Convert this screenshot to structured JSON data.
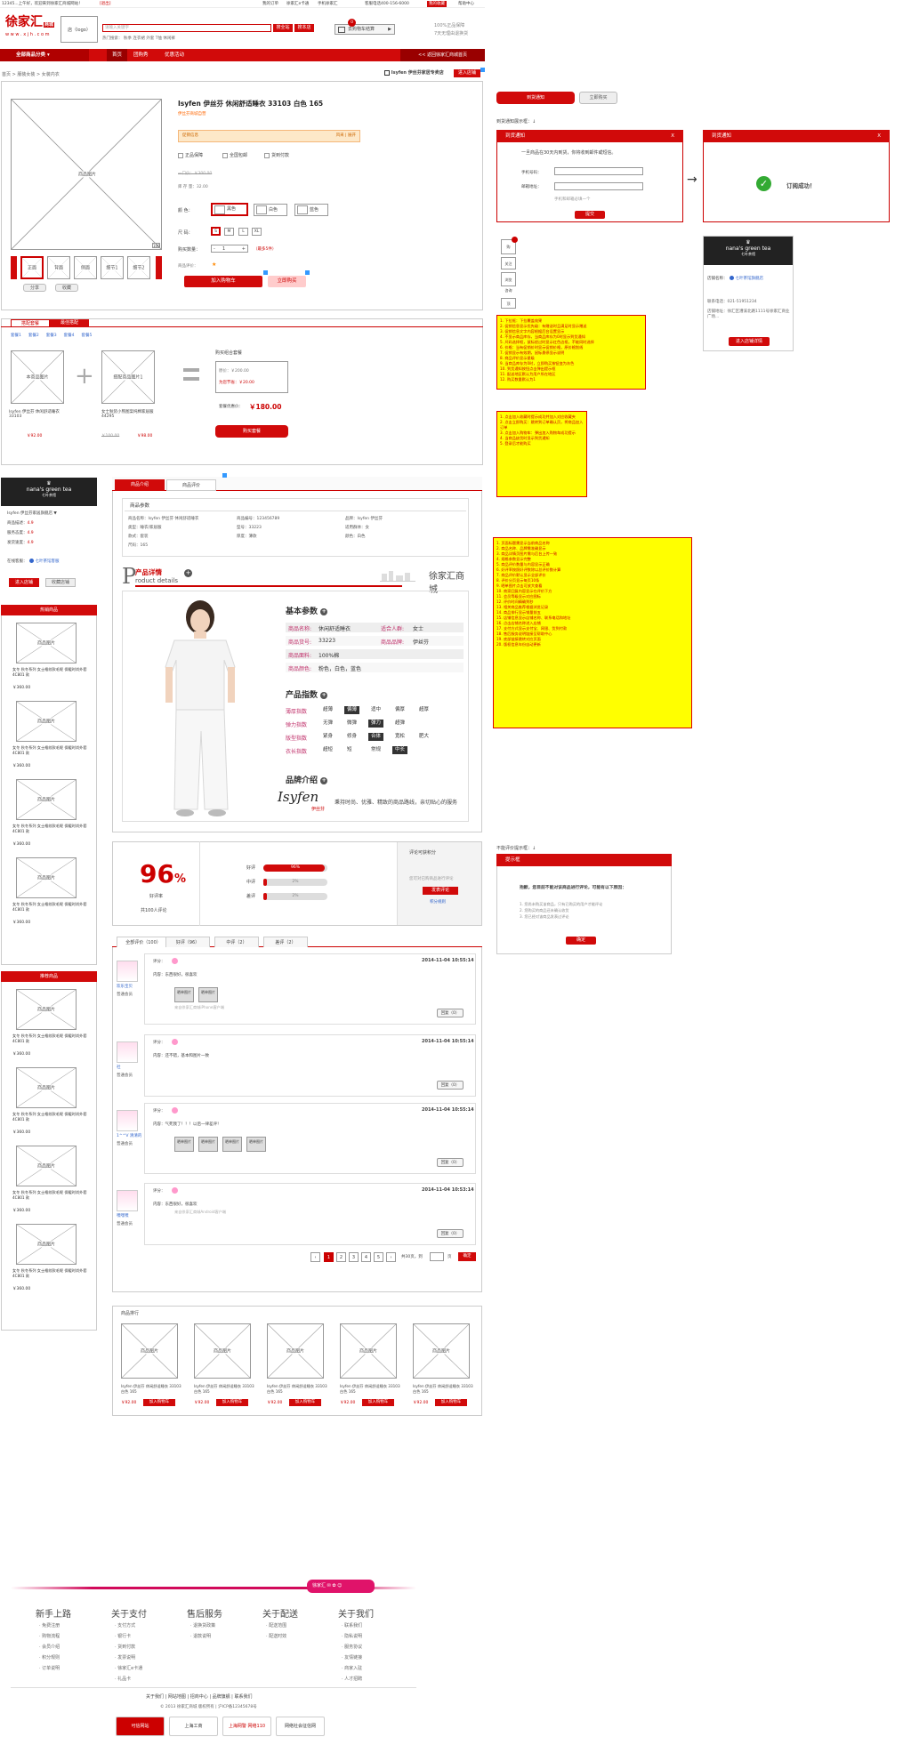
{
  "topbar": {
    "greeting": "12345...上午好，欢迎来到徐家汇商城网站！",
    "logout": "[退出]",
    "links": [
      "我的订单",
      "徐家汇e卡通",
      "手机徐家汇",
      "客服电话400-156-6000",
      "我的收藏",
      "帮助中心"
    ],
    "fav_btn": "加入收藏"
  },
  "header": {
    "logo_cn": "徐家汇",
    "logo_sub": "商城",
    "logo_url": "w w w . x j h . c o m",
    "store_logo": "店（logo）",
    "search_placeholder": "请输入关键字",
    "search_btn": "搜全站",
    "search_store_btn": "搜本店",
    "hot_words": "热门搜索：  秋季  连衣裙  外套  T恤  休闲裤",
    "cart_label": "去购物车结算",
    "cart_count": "0",
    "slogan1": "100%正品保障",
    "slogan2": "7天无理由退换货"
  },
  "nav": {
    "all_categories": "全部商品分类",
    "items": [
      "首页",
      "团购秀",
      "优惠活动"
    ],
    "back_link": "<< 返回徐家汇商城首页"
  },
  "breadcrumb": "首页 > 服装女装 > 女装内衣",
  "store_bar": {
    "name": "Isyfen 伊丝芬家居专卖店",
    "enter": "进入店铺"
  },
  "product": {
    "title": "Isyfen 伊丝芬 休闲舒适睡衣 33103 白色 165",
    "subtitle": "伊丝芬商城自营",
    "promo_label": "促销信息",
    "promo_more": "风采 | 展开",
    "service": [
      "正品保障",
      "全国包邮",
      "货到付款"
    ],
    "price_line": "一口价：￥300.00",
    "stock": "库 存 量：32.00",
    "color_label": "颜 色：",
    "colors": [
      "黑色",
      "白色",
      "蓝色"
    ],
    "size_label": "尺 码：",
    "sizes": [
      "S",
      "M",
      "L",
      "XL"
    ],
    "qty_label": "购买数量：",
    "qty": "1",
    "qty_note": "（最多5件）",
    "rating_label": "商品评价：",
    "add_cart": "加入购物车",
    "buy_now": "立即购买",
    "thumbs": [
      "正面",
      "背面",
      "侧面",
      "细节1",
      "细节2"
    ],
    "share": "分享",
    "collect": "收藏",
    "main_img": "商品图片"
  },
  "bundle": {
    "tabs": [
      "搭配套餐",
      "最佳搭配"
    ],
    "groups": [
      "套餐1",
      "套餐2",
      "套餐3",
      "套餐4",
      "套餐5"
    ],
    "item1": "本商品图片",
    "item1_name": "Isyfen 伊丝芬 休闲舒适睡衣 33103",
    "item1_price": "￥92.00",
    "item2": "搭配商品图片1",
    "item2_name": "女士秋装小熊图案纯棉家居服 44295",
    "item2_old": "￥100.00",
    "item2_price": "￥98.00",
    "combo_title": "购买组合套餐",
    "combo_orig": "原价：￥200.00",
    "combo_save": "为您节省：￥20.00",
    "combo_price_label": "套餐优惠价：",
    "combo_price": "￥180.00",
    "combo_btn": "购买套餐"
  },
  "arrival": {
    "btn1": "到货通知",
    "btn2": "立即购买",
    "caption": "到货通知展示框：↓",
    "dialog_title": "到货通知",
    "dialog_text": "一旦商品在30天内到货，你将收到邮件或短信。",
    "phone_label": "手机号码：",
    "email_label": "邮箱地址：",
    "email_note": "手机和邮箱必填一个",
    "submit": "提交",
    "success_title": "到货通知",
    "success_text": "订阅成功！"
  },
  "side_icons": [
    "购",
    "关注",
    "浏览",
    "咨询",
    "顶"
  ],
  "store_card": {
    "name": "nana's green tea",
    "sub": "七叶茶馆",
    "store_label": "店铺名称：",
    "store": "七叶茶馆旗舰店",
    "phone": "联系电话：021-51951234",
    "addr": "店铺地址：徐汇区漕溪北路1111号徐家汇商业广场...",
    "enter": "进入店铺详情"
  },
  "note1": "1. 下拉框：下拉覆盖效果\n2. 促销信息显示优先级：有赠送时且满足时显示赠送\n3. 促销信息文字内容根据后台设置显示\n4. 不显示商品库存，当商品库存为0时显示到货通知\n5. 尺码选择框，鼠标经过时显示红色边框，不能同时选择\n6. 价格：当有促销价时显示促销价格，原价格划线\n7. 促销显示有效期，鼠标悬停显示说明\n8. 商品评价显示星级\n9. 当商品库存为0时，立即购买按钮变为灰色\n10. 到货通知按钮点击弹出提示框\n11. 配送地区默认为用户所在地区\n12. 购买数量默认为1",
  "note2": "1. 点击加入收藏时提示成功并加入对应收藏夹\n2. 点击立即购买：跳转到订单确认页，将商品加入订单\n3. 点击加入购物车：弹出加入购物车成功提示\n4. 当商品缺货时显示到货通知\n5. 登录后才能购买",
  "note3": "1. 页面标题需显示当前商品名称\n2. 商品名称、品牌需准确显示\n3. 商品详情页图片需与后台上传一致\n4. 规格参数显示完整\n5. 商品评价数量与内容显示正确\n6. 好评率按照好评数除以总评价数计算\n7. 商品评价默认显示全部评价\n8. 评价分页显示每页10条\n9. 晒单图片点击可放大查看\n10. 商家回复内容显示在评价下方\n11. 会员等级显示对应图标\n12. 评价时间精确到秒\n13. 相关商品推荐根据浏览记录\n14. 商品排行显示销量前五\n15. 店铺信息显示店铺名称、联系电话和地址\n16. 点击店铺名称进入店铺\n17. 支付方式显示支付宝、网银、货到付款\n18. 售后服务说明链接至帮助中心\n19. 底部链接跳转对应页面\n20. 版权信息年份自动更新",
  "store_side": {
    "name": "nana's green tea",
    "sub": "七叶茶馆",
    "select": "Isyfen 伊丝芬家居旗舰店",
    "scores": [
      [
        "商品描述：",
        "4.9"
      ],
      [
        "服务态度：",
        "4.9"
      ],
      [
        "发货速度：",
        "4.9"
      ]
    ],
    "online_label": "在线客服：",
    "online": "七叶茶馆客服",
    "enter": "进入店铺",
    "collect": "收藏店铺",
    "hot_title": "热销商品",
    "rec_title": "推荐商品",
    "item_img": "商品图片",
    "item_name": "女冬 秋冬系列 女士格纹款毛呢 保暖时尚外套 4C801 款",
    "item_price": "￥360.00"
  },
  "detail": {
    "tabs": [
      "商品介绍",
      "商品评价"
    ],
    "param_title": "商品参数",
    "params": [
      [
        "商品名称：Isyfen 伊丝芬 休闲舒适睡衣",
        "商品编号：123456789",
        "品牌：Isyfen 伊丝芬"
      ],
      [
        "类型：睡衣/家居服",
        "型号：33223",
        "适用群体：女"
      ],
      [
        "款式：套装",
        "厚度：薄款",
        "颜色：白色"
      ],
      [
        "尺码：165",
        "",
        ""
      ]
    ],
    "banner_cn": "产品详情",
    "banner_en": "roduct details",
    "brand_logo": "徐家汇商城",
    "basic_title": "基本参数",
    "basic": [
      [
        "商品名称:",
        "休闲舒适睡衣",
        "适合人群:",
        "女士"
      ],
      [
        "商品货号:",
        "33223",
        "商品品牌:",
        "伊丝芬"
      ],
      [
        "商品面料:",
        "100%棉",
        "",
        ""
      ],
      [
        "商品颜色:",
        "粉色，白色，蓝色",
        "",
        ""
      ]
    ],
    "index_title": "产品指数",
    "indexes": [
      [
        "薄厚指数",
        "超薄",
        "偏薄",
        "适中",
        "偏厚",
        "超厚"
      ],
      [
        "弹力指数",
        "无弹",
        "微弹",
        "弹力",
        "超弹",
        ""
      ],
      [
        "版型指数",
        "紧身",
        "修身",
        "合体",
        "宽松",
        "肥大"
      ],
      [
        "衣长指数",
        "超短",
        "短",
        "常规",
        "中长",
        ""
      ]
    ],
    "brand_title": "品牌介绍",
    "brand_text": "秉持时尚、优雅、精致的商品路线，亲切贴心的服务",
    "brand_sig": "Isyfen",
    "brand_cn": "伊丝芬"
  },
  "review": {
    "rate": "96",
    "pct": "%",
    "rate_label": "好评率",
    "count": "共100人评论",
    "bars": [
      [
        "好评",
        "96%"
      ],
      [
        "中评",
        "2%"
      ],
      [
        "差评",
        "2%"
      ]
    ],
    "right_title": "评论可获积分",
    "right_text": "您可对已购商品进行评论",
    "btn": "发表评论",
    "link": "积分规则",
    "tabs": [
      "全部评价（100）",
      "好评（96）",
      "中评（2）",
      "差评（2）"
    ]
  },
  "comments": [
    {
      "user": "欢乐宝贝",
      "level": "普通会员",
      "score": "评分：",
      "text": "内容：东西很好，很喜欢",
      "imgs": [
        "晒单图片",
        "晒单图片"
      ],
      "note": "来自徐家汇商城iPhone客户端",
      "date": "2014-11-04  10:55:14",
      "reply": "回复（0）"
    },
    {
      "user": "社",
      "level": "普通会员",
      "score": "评分：",
      "text": "内容：还不错，基本和图片一致",
      "imgs": [],
      "note": "",
      "date": "2014-11-04  10:55:14",
      "reply": "回复（0）"
    },
    {
      "user": "1^^V 清清的",
      "level": "普通会员",
      "score": "评分：",
      "text": "内容：气死我了！！！以后一律差评！",
      "imgs": [
        "晒单图片",
        "晒单图片",
        "晒单图片",
        "晒单图片"
      ],
      "note": "",
      "date": "2014-11-04  10:55:14",
      "reply": "回复（0）"
    },
    {
      "user": "嘿嘿嘿",
      "level": "普通会员",
      "score": "评分：",
      "text": "内容：东西很好，很喜欢",
      "imgs": [],
      "note": "来自徐家汇商城Android客户端",
      "date": "2014-11-04  10:53:14",
      "reply": "回复（0）"
    }
  ],
  "pager": {
    "pages": [
      "1",
      "2",
      "3",
      "4",
      "5"
    ],
    "total": "共30页，到",
    "page": "页",
    "go": "确定"
  },
  "ranking": {
    "title": "商品排行",
    "img": "商品图片",
    "name": "Isyfen 伊丝芬 休闲舒适睡衣 33103 白色 165",
    "price": "￥92.00",
    "btn": "加入购物车"
  },
  "eval_dialog": {
    "caption": "不能评价提示框：↓",
    "title": "提示框",
    "text": "抱歉，您目前不能对该商品进行评论，可能有以下原因：",
    "reasons": [
      "1. 您尚未购买该商品，只有已购买的用户才能评论",
      "2. 您购买的商品还未确认收货",
      "3. 您已经对该商品发表过评论"
    ],
    "ok": "确定"
  },
  "footer": {
    "badge": "徐家汇",
    "cols": [
      {
        "h": "新手上路",
        "items": [
          "免费注册",
          "购物流程",
          "会员介绍",
          "积分规则",
          "订单说明"
        ]
      },
      {
        "h": "关于支付",
        "items": [
          "支付方式",
          "银行卡",
          "货到付款",
          "发票说明",
          "徐家汇e卡通",
          "礼品卡"
        ]
      },
      {
        "h": "售后服务",
        "items": [
          "退换货政策",
          "退款说明"
        ]
      },
      {
        "h": "关于配送",
        "items": [
          "配送范围",
          "配送时效"
        ]
      },
      {
        "h": "关于我们",
        "items": [
          "联系我们",
          "隐私说明",
          "服务协议",
          "友情链接",
          "商家入驻",
          "人才招聘"
        ]
      }
    ],
    "links": "关于我们  |  网站地图  |  招商中心  |  品牌旗舰  |  联系我们",
    "copyright": "© 2013 徐家汇商城 版权所有 | 沪ICP备12345678号",
    "badges": [
      "可信网站",
      "上海工商",
      "上海网警 网络110",
      "网络社会征信网"
    ]
  }
}
